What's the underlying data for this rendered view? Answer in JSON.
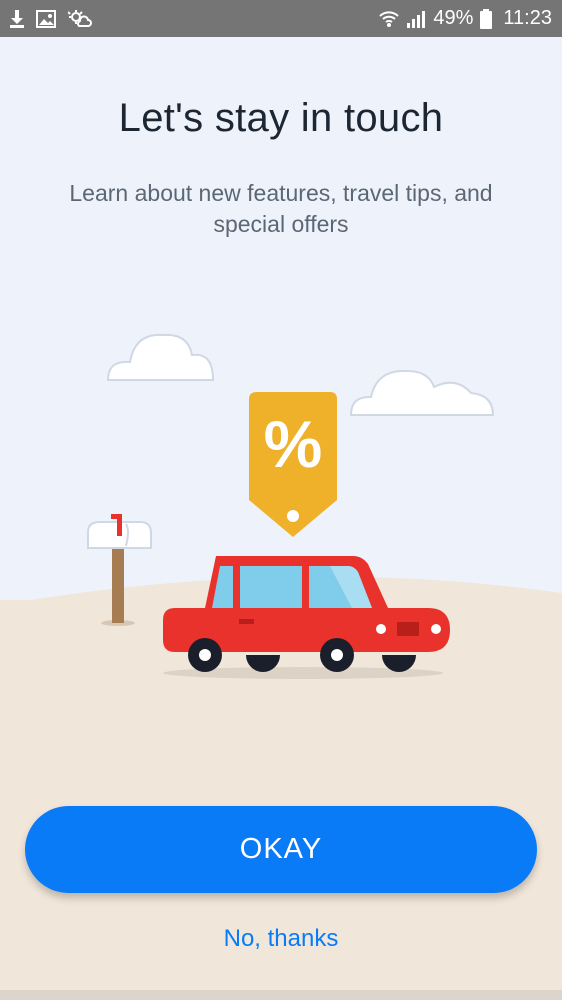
{
  "status_bar": {
    "battery": "49%",
    "time": "11:23",
    "left_icons": [
      "download-icon",
      "image-icon",
      "weather-icon"
    ],
    "right_icons": [
      "wifi-icon",
      "signal-icon",
      "battery-icon"
    ]
  },
  "header": {
    "title": "Let's stay in touch",
    "subtitle": "Learn about new features, travel tips, and special offers"
  },
  "illustration": {
    "tag_symbol": "%",
    "colors": {
      "sky": "#eef3fb",
      "ground": "#f1e6da",
      "car": "#e8322b",
      "tag": "#f0b12a",
      "window": "#7fcdeb"
    }
  },
  "actions": {
    "okay_label": "OKAY",
    "no_thanks_label": "No, thanks"
  },
  "colors": {
    "accent": "#0a7bf7",
    "title": "#1d2633",
    "subtitle": "#5c6775",
    "status_bar": "#757575"
  }
}
